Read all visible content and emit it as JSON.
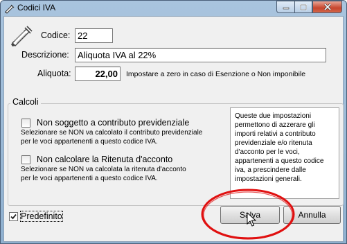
{
  "window": {
    "title": "Codici IVA"
  },
  "form": {
    "codice_label": "Codice:",
    "codice_value": "22",
    "descrizione_label": "Descrizione:",
    "descrizione_value": "Aliquota IVA al 22%",
    "aliquota_label": "Aliquota:",
    "aliquota_value": "22,00",
    "aliquota_hint": "Impostare a zero in caso di Esenzione o Non imponibile"
  },
  "calcoli": {
    "title": "Calcoli",
    "contributo_label": "Non soggetto a contributo previdenziale",
    "contributo_desc_1": "Selezionare se NON va calcolato il contributo previdenziale",
    "contributo_desc_2": "per le voci appartenenti a questo codice IVA.",
    "ritenuta_label": "Non calcolare la Ritenuta d'acconto",
    "ritenuta_desc_1": "Selezionare se NON va calcolata la ritenuta d'acconto",
    "ritenuta_desc_2": "per le voci appartenenti a questo codice IVA.",
    "info_text": "Queste due impostazioni permettono di azzerare gli importi relativi a contributo previdenziale e/o ritenuta d'acconto per le voci, appartenenti a questo codice iva, a prescindere dalle impostazioni generali."
  },
  "footer": {
    "predefinito_label": "Predefinito",
    "predefinito_checked": true,
    "salva_label": "Salva",
    "annulla_label": "Annulla"
  },
  "colors": {
    "annotation": "#e01010",
    "titlebar": "#a9c4de",
    "close_button": "#c7452c"
  }
}
